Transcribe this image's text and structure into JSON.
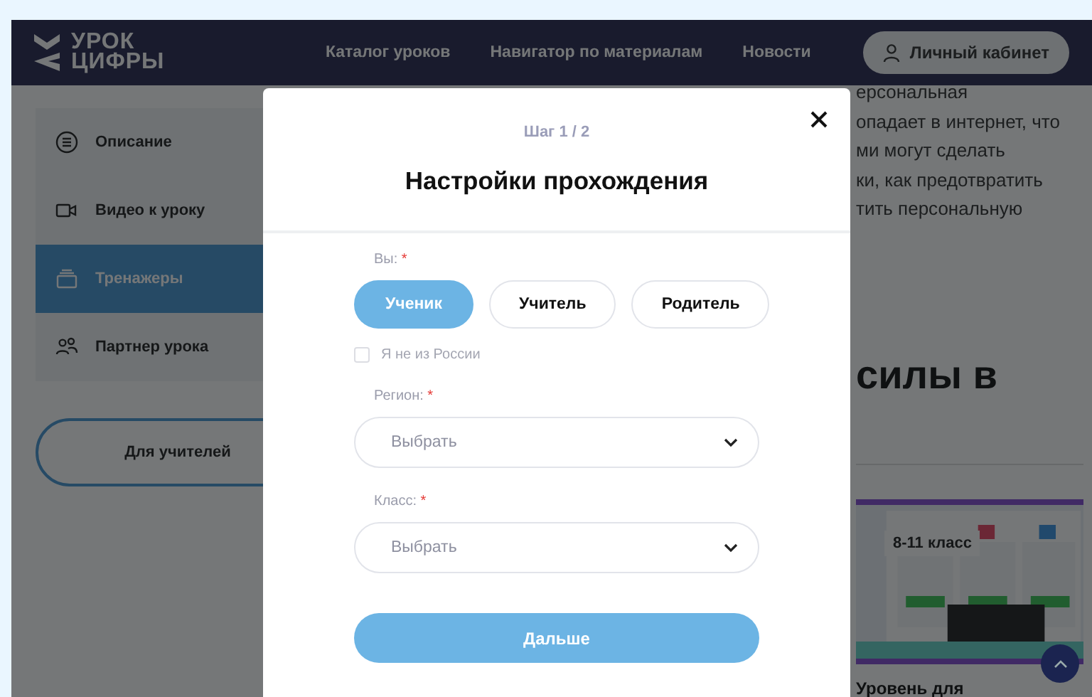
{
  "header": {
    "logo": [
      "УРОК",
      "ЦИФРЫ"
    ],
    "nav": [
      {
        "label": "Каталог уроков"
      },
      {
        "label": "Навигатор по материалам"
      },
      {
        "label": "Новости"
      }
    ],
    "account_button": "Личный кабинет"
  },
  "sidebar": {
    "items": [
      {
        "label": "Описание",
        "selected": false
      },
      {
        "label": "Видео к уроку",
        "selected": false
      },
      {
        "label": "Тренажеры",
        "selected": true
      },
      {
        "label": "Партнер урока",
        "selected": false
      }
    ],
    "teacher_button": "Для учителей"
  },
  "background": {
    "text_lines": [
      "ерсональная",
      "опадает в интернет, что",
      "ми могут сделать",
      "ки, как предотвратить",
      "тить персональную"
    ],
    "heading": "силы в",
    "card": {
      "badge": "8-11 класс",
      "title": "Уровень для"
    }
  },
  "modal": {
    "step": "Шаг 1 / 2",
    "title": "Настройки прохождения",
    "role_label": {
      "text": "Вы:",
      "mark": "*"
    },
    "roles": [
      {
        "label": "Ученик",
        "selected": true
      },
      {
        "label": "Учитель",
        "selected": false
      },
      {
        "label": "Родитель",
        "selected": false
      }
    ],
    "not_from_russia": {
      "label": "Я не из России",
      "checked": false
    },
    "fields": [
      {
        "label": "Регион:",
        "mark": "*",
        "placeholder": "Выбрать"
      },
      {
        "label": "Класс:",
        "mark": "*",
        "placeholder": "Выбрать"
      }
    ],
    "next_button": "Дальше"
  }
}
